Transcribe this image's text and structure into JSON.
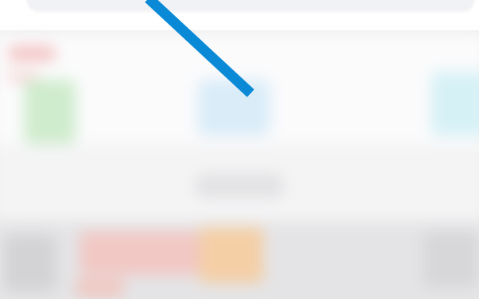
{
  "search": {
    "placeholder": ""
  },
  "gesture": {
    "color": "#0a8ad6"
  },
  "colors": {
    "background": "#ececed",
    "blur_tile_red": "#f3c0c0",
    "blur_tile_green": "#cfeccd",
    "blur_tile_blue": "#d9ecf8",
    "blur_tile_cyan": "#d6f1f6",
    "blur_tile_orange": "#f4cfa6"
  }
}
